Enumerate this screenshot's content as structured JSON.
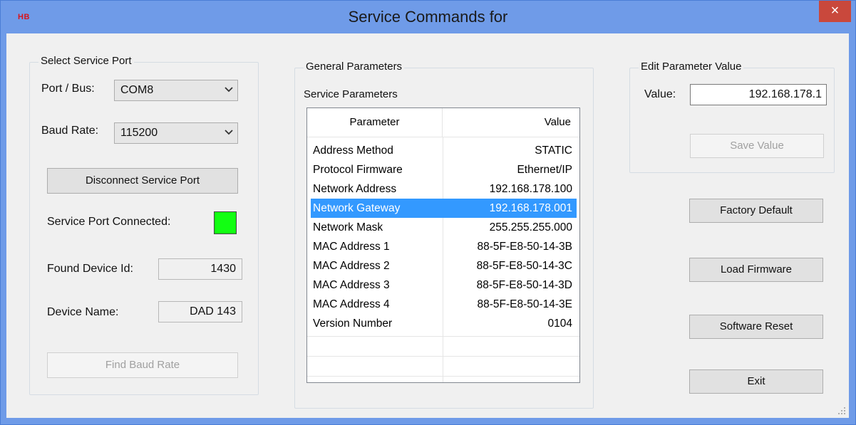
{
  "window": {
    "app_icon_text": "HB",
    "title": "Service Commands for",
    "close_glyph": "×"
  },
  "select_port": {
    "group_label": "Select Service Port",
    "port_label": "Port / Bus:",
    "port_value": "COM8",
    "baud_label": "Baud Rate:",
    "baud_value": "115200",
    "disconnect_button": "Disconnect Service Port",
    "connected_label": "Service Port Connected:",
    "connected_color": "#12ff12",
    "device_id_label": "Found Device Id:",
    "device_id_value": "1430",
    "device_name_label": "Device Name:",
    "device_name_value": "DAD 143",
    "find_baud_button": "Find Baud Rate"
  },
  "general": {
    "group_label": "General Parameters",
    "service_params_label": "Service Parameters",
    "columns": [
      "Parameter",
      "Value"
    ],
    "rows": [
      {
        "parameter": "Address Method",
        "value": "STATIC"
      },
      {
        "parameter": "Protocol Firmware",
        "value": "Ethernet/IP"
      },
      {
        "parameter": "Network Address",
        "value": "192.168.178.100"
      },
      {
        "parameter": "Network Gateway",
        "value": "192.168.178.001",
        "selected": true
      },
      {
        "parameter": "Network Mask",
        "value": "255.255.255.000"
      },
      {
        "parameter": "MAC Address 1",
        "value": "88-5F-E8-50-14-3B"
      },
      {
        "parameter": "MAC Address 2",
        "value": "88-5F-E8-50-14-3C"
      },
      {
        "parameter": "MAC Address 3",
        "value": "88-5F-E8-50-14-3D"
      },
      {
        "parameter": "MAC Address 4",
        "value": "88-5F-E8-50-14-3E"
      },
      {
        "parameter": "Version Number",
        "value": "0104"
      }
    ]
  },
  "edit": {
    "group_label": "Edit Parameter Value",
    "value_label": "Value:",
    "value": "192.168.178.1",
    "save_button": "Save Value"
  },
  "actions": {
    "factory_default": "Factory Default",
    "load_firmware": "Load Firmware",
    "software_reset": "Software Reset",
    "exit": "Exit"
  }
}
